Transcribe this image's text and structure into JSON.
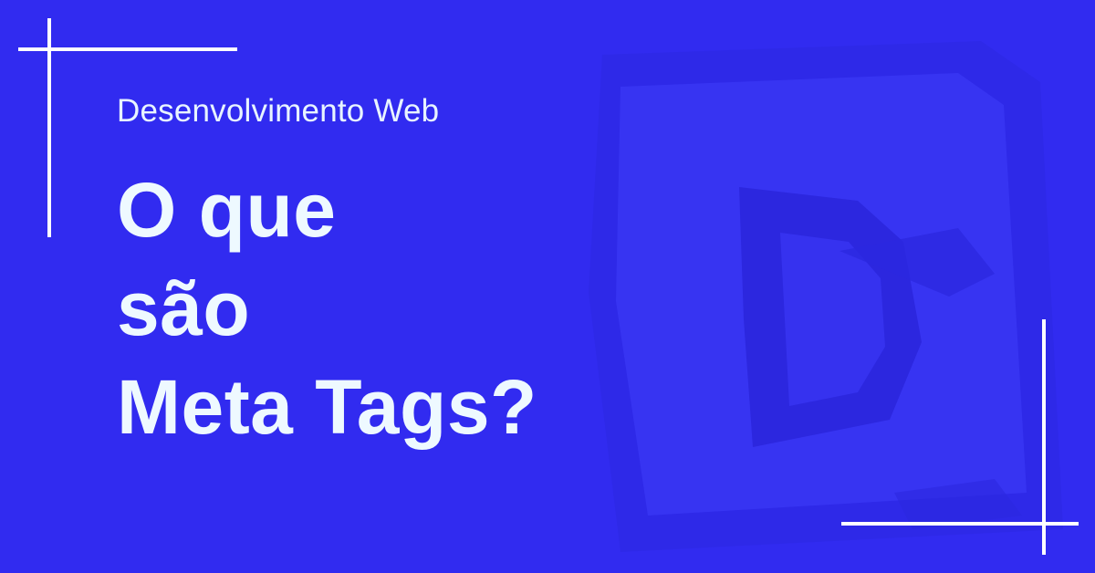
{
  "banner": {
    "category": "Desenvolvimento Web",
    "title_lines": [
      "O que",
      "são",
      "Meta Tags?"
    ],
    "logo": "brush-stroke-logo-watermark"
  },
  "colors": {
    "background": "#312bf0",
    "text": "#eef9ff",
    "lines": "#ffffff",
    "watermark_light": "#3d39f5",
    "watermark_dark": "#2a25dc"
  }
}
